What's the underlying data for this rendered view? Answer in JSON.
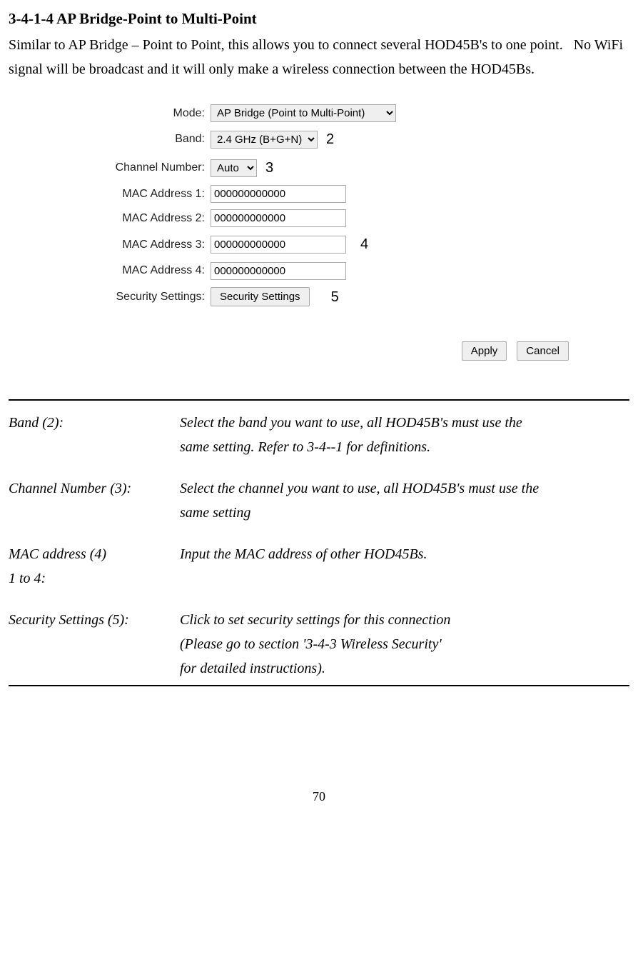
{
  "heading": "3-4-1-4 AP Bridge-Point to Multi-Point",
  "intro": "Similar to AP Bridge – Point to Point, this allows you to connect several HOD45B's to one point.   No WiFi signal will be broadcast and it will only make a wireless connection between the HOD45Bs.",
  "form": {
    "mode_label": "Mode:",
    "mode_value": "AP Bridge (Point to Multi-Point)",
    "band_label": "Band:",
    "band_value": "2.4 GHz (B+G+N)",
    "channel_label": "Channel Number:",
    "channel_value": "Auto",
    "mac1_label": "MAC Address 1:",
    "mac1_value": "000000000000",
    "mac2_label": "MAC Address 2:",
    "mac2_value": "000000000000",
    "mac3_label": "MAC Address 3:",
    "mac3_value": "000000000000",
    "mac4_label": "MAC Address 4:",
    "mac4_value": "000000000000",
    "security_label": "Security Settings:",
    "security_button": "Security Settings",
    "apply": "Apply",
    "cancel": "Cancel"
  },
  "callouts": {
    "c2": "2",
    "c3": "3",
    "c4": "4",
    "c5": "5"
  },
  "definitions": {
    "band_term": "Band (2):",
    "band_desc1": "Select the band you want to use, all HOD45B's must use the",
    "band_desc2": "same setting. Refer to 3-4--1 for definitions.",
    "channel_term": "Channel Number (3):",
    "channel_desc1": "Select the channel you want to use, all HOD45B's must use the",
    "channel_desc2": "same setting",
    "mac_term1": "MAC address (4)",
    "mac_term2": "1 to 4:",
    "mac_desc": "Input the MAC address of other HOD45Bs.",
    "security_term": "Security Settings (5):",
    "security_desc1": "Click to set security settings for this connection",
    "security_desc2": "(Please go to section '3-4-3 Wireless Security'",
    "security_desc3": "for detailed instructions)."
  },
  "page_number": "70"
}
